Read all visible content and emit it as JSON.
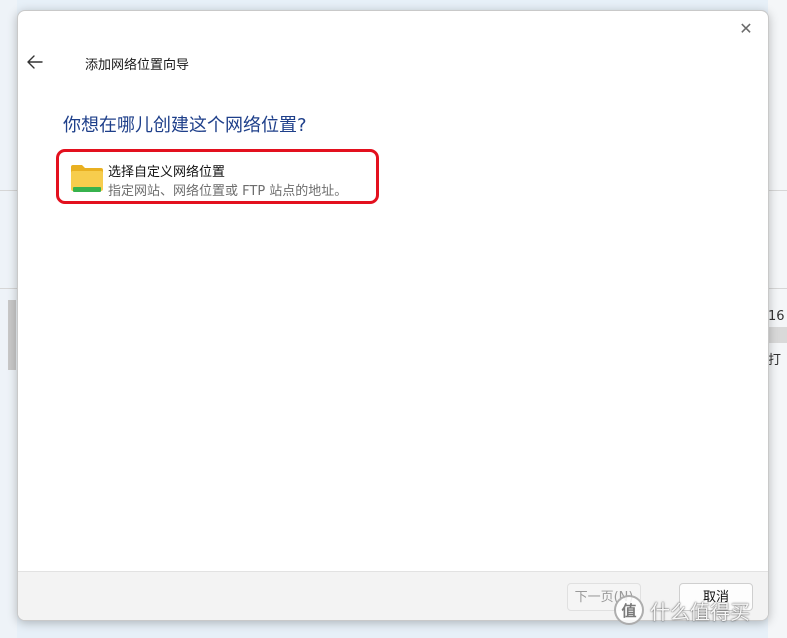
{
  "background": {
    "fragment_top": "16",
    "fragment_bottom": "打"
  },
  "dialog": {
    "title": "添加网络位置向导",
    "close_glyph": "✕",
    "question": "你想在哪儿创建这个网络位置?",
    "option": {
      "title": "选择自定义网络位置",
      "description": "指定网站、网络位置或 FTP 站点的地址。",
      "icon": "folder-icon"
    },
    "footer": {
      "next_label": "下一页(N)",
      "cancel_label": "取消"
    }
  },
  "watermark": {
    "logo_text": "值",
    "text": "什么值得买"
  },
  "colors": {
    "question": "#1e3f8a",
    "highlight_border": "#e3101e",
    "folder": "#f5c843",
    "folder_accent": "#37b24d"
  }
}
